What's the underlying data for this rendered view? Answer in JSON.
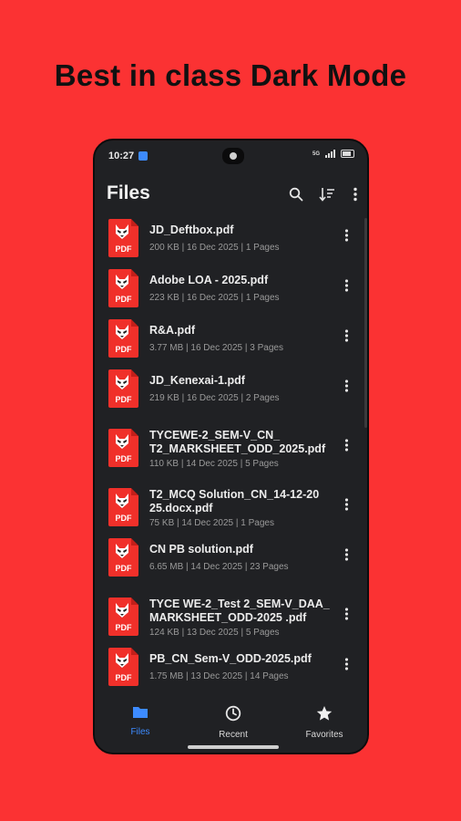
{
  "headline": "Best in class Dark Mode",
  "status": {
    "time": "10:27",
    "signal_label": "5G"
  },
  "appbar": {
    "title": "Files",
    "search_icon": "search-icon",
    "sort_icon": "sort-icon",
    "more_icon": "more-vert-icon"
  },
  "files": [
    {
      "name": "JD_Deftbox.pdf",
      "meta": "200 KB  |  16 Dec 2025  |  1 Pages"
    },
    {
      "name": "Adobe LOA - 2025.pdf",
      "meta": "223 KB  |  16 Dec 2025  |  1 Pages"
    },
    {
      "name": "R&A.pdf",
      "meta": "3.77 MB  |  16 Dec 2025  |  3 Pages"
    },
    {
      "name": "JD_Kenexai-1.pdf",
      "meta": "219 KB  |  16 Dec 2025  |  2 Pages"
    },
    {
      "name": "TYCEWE-2_SEM-V_CN_ T2_MARKSHEET_ODD_2025.pdf",
      "meta": "110 KB  |  14 Dec 2025  |  5 Pages"
    },
    {
      "name": "T2_MCQ Solution_CN_14-12-20 25.docx.pdf",
      "meta": "75 KB  |  14 Dec 2025  |  1 Pages"
    },
    {
      "name": "CN PB solution.pdf",
      "meta": "6.65 MB  |  14 Dec 2025  |  23 Pages"
    },
    {
      "name": "TYCE WE-2_Test 2_SEM-V_DAA_ MARKSHEET_ODD-2025 .pdf",
      "meta": "124 KB  |  13 Dec 2025  |  5 Pages"
    },
    {
      "name": "PB_CN_Sem-V_ODD-2025.pdf",
      "meta": "1.75 MB  |  13 Dec 2025  |  14 Pages"
    }
  ],
  "pdf_label": "PDF",
  "nav": {
    "files": "Files",
    "recent": "Recent",
    "favorites": "Favorites"
  },
  "colors": {
    "background": "#fb3233",
    "surface": "#202124",
    "accent": "#3d8bff",
    "pdf_red": "#f0302a"
  }
}
